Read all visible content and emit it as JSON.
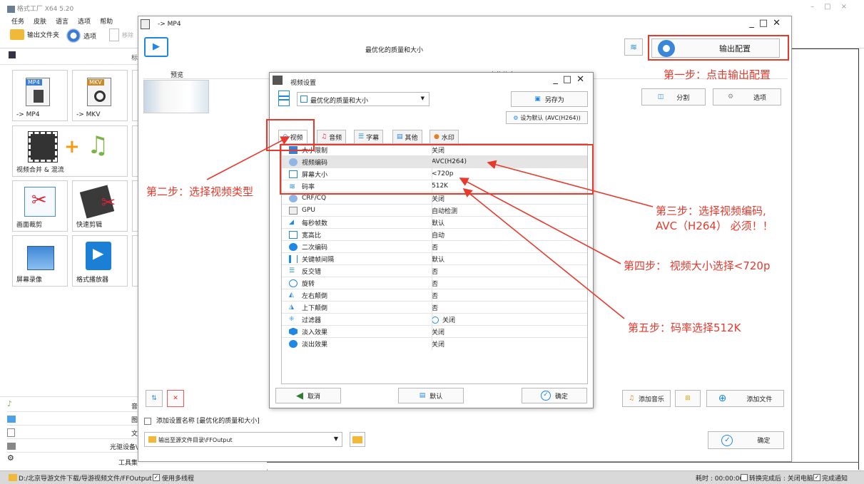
{
  "app": {
    "title": "格式工厂 X64 5.20",
    "menus": [
      "任务",
      "皮肤",
      "语言",
      "选项",
      "帮助"
    ],
    "toolbar": {
      "output_folder": "输出文件夹",
      "options": "选项",
      "remove": "移除"
    }
  },
  "left": {
    "tiles": [
      "-> MP4",
      "-> MKV",
      "视频合并 & 混流",
      "画面裁剪",
      "快速剪辑",
      "屏幕录像",
      "格式播放器"
    ],
    "mp4_badge": "MP4",
    "mkv_badge": "MKV",
    "sections": [
      "音",
      "图",
      "文",
      "光驱设备\\",
      "工具集"
    ]
  },
  "status": {
    "path": "D:/北京导游文件下载/导游视频文件/FFOutput",
    "multithread": "使用多线程",
    "elapsed": "耗时 : 00:00:00",
    "after": "转换完成后 : 关闭电脑",
    "notify": "完成通知"
  },
  "mp4win": {
    "title": "-> MP4",
    "subtitle": "最优化的质量和大小",
    "output_config": "输出配置",
    "preview_col": "预览",
    "file_col": "文件信息",
    "split": "分割",
    "options": "选项",
    "add_music": "添加音乐",
    "add_file": "添加文件",
    "add_setting": "添加设置名称 [最优化的质量和大小]",
    "output_path": "输出至源文件目录\\FFOutput",
    "ok": "确定"
  },
  "vs": {
    "title": "视频设置",
    "preset": "最优化的质量和大小",
    "save_as": "另存为",
    "set_default": "设为默认 (AVC(H264))",
    "tabs": [
      "视频",
      "音频",
      "字幕",
      "其他",
      "水印"
    ],
    "rows": [
      [
        "大小限制",
        "关闭"
      ],
      [
        "视频编码",
        "AVC(H264)"
      ],
      [
        "屏幕大小",
        "<720p"
      ],
      [
        "码率",
        "512K"
      ],
      [
        "CRF/CQ",
        "关闭"
      ],
      [
        "GPU",
        "自动检测"
      ],
      [
        "每秒帧数",
        "默认"
      ],
      [
        "宽高比",
        "自动"
      ],
      [
        "二次编码",
        "否"
      ],
      [
        "关键帧间隔",
        "默认"
      ],
      [
        "反交错",
        "否"
      ],
      [
        "旋转",
        "否"
      ],
      [
        "左右颠倒",
        "否"
      ],
      [
        "上下颠倒",
        "否"
      ],
      [
        "过滤器",
        "关闭"
      ],
      [
        "淡入效果",
        "关闭"
      ],
      [
        "淡出效果",
        "关闭"
      ]
    ],
    "cancel": "取消",
    "default": "默认",
    "ok": "确定"
  },
  "ann": {
    "s1": "第一步：点击输出配置",
    "s2": "第二步：选择视频类型",
    "s3a": "第三步：选择视频编码,",
    "s3b": "AVC（H264） 必须！！",
    "s4": "第四步： 视频大小选择<720p",
    "s5": "第五步：码率选择512K"
  },
  "colors": {
    "accent": "#1e88e5",
    "annot": "#e8392d"
  }
}
